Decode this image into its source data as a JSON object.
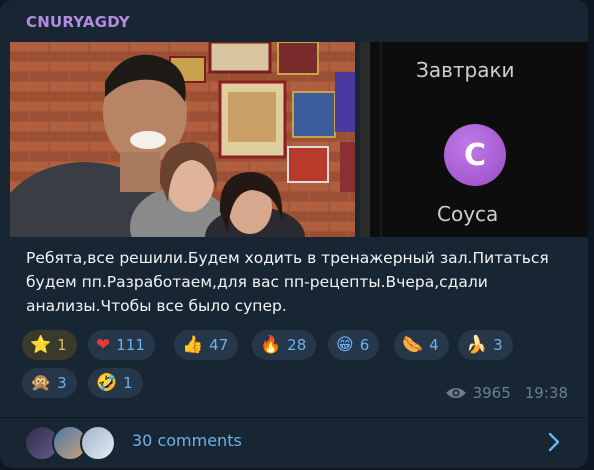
{
  "post": {
    "channel_name": "CNURYAGDY",
    "photo_right_title": "Завтраки",
    "photo_right_label": "Соуса",
    "photo_right_badge_letter": "С",
    "text": "Ребята,все решили.Будем ходить в тренажерный зал.Питаться будем пп.Разработаем,для вас пп-рецепты.Вчера,сдали анализы.Чтобы все было супер."
  },
  "reactions": [
    {
      "emoji": "⭐",
      "count": "1",
      "icon": "star-icon",
      "active": true
    },
    {
      "emoji": "❤",
      "count": "111",
      "icon": "heart-icon"
    },
    {
      "emoji": "👍",
      "count": "47",
      "icon": "thumbs-up-icon"
    },
    {
      "emoji": "🔥",
      "count": "28",
      "icon": "fire-icon"
    },
    {
      "emoji": "😁",
      "count": "6",
      "icon": "grin-icon"
    },
    {
      "emoji": "🌭",
      "count": "4",
      "icon": "hotdog-icon"
    },
    {
      "emoji": "🍌",
      "count": "3",
      "icon": "banana-icon"
    },
    {
      "emoji": "🙊",
      "count": "3",
      "icon": "monkey-icon"
    },
    {
      "emoji": "🤣",
      "count": "1",
      "icon": "rofl-icon"
    }
  ],
  "meta": {
    "views": "3965",
    "time": "19:38"
  },
  "comments": {
    "label": "30 comments"
  },
  "colors": {
    "accent": "#6ab2f2",
    "channel": "#b28ce0",
    "bubble": "#182533",
    "chip": "#27374a"
  }
}
